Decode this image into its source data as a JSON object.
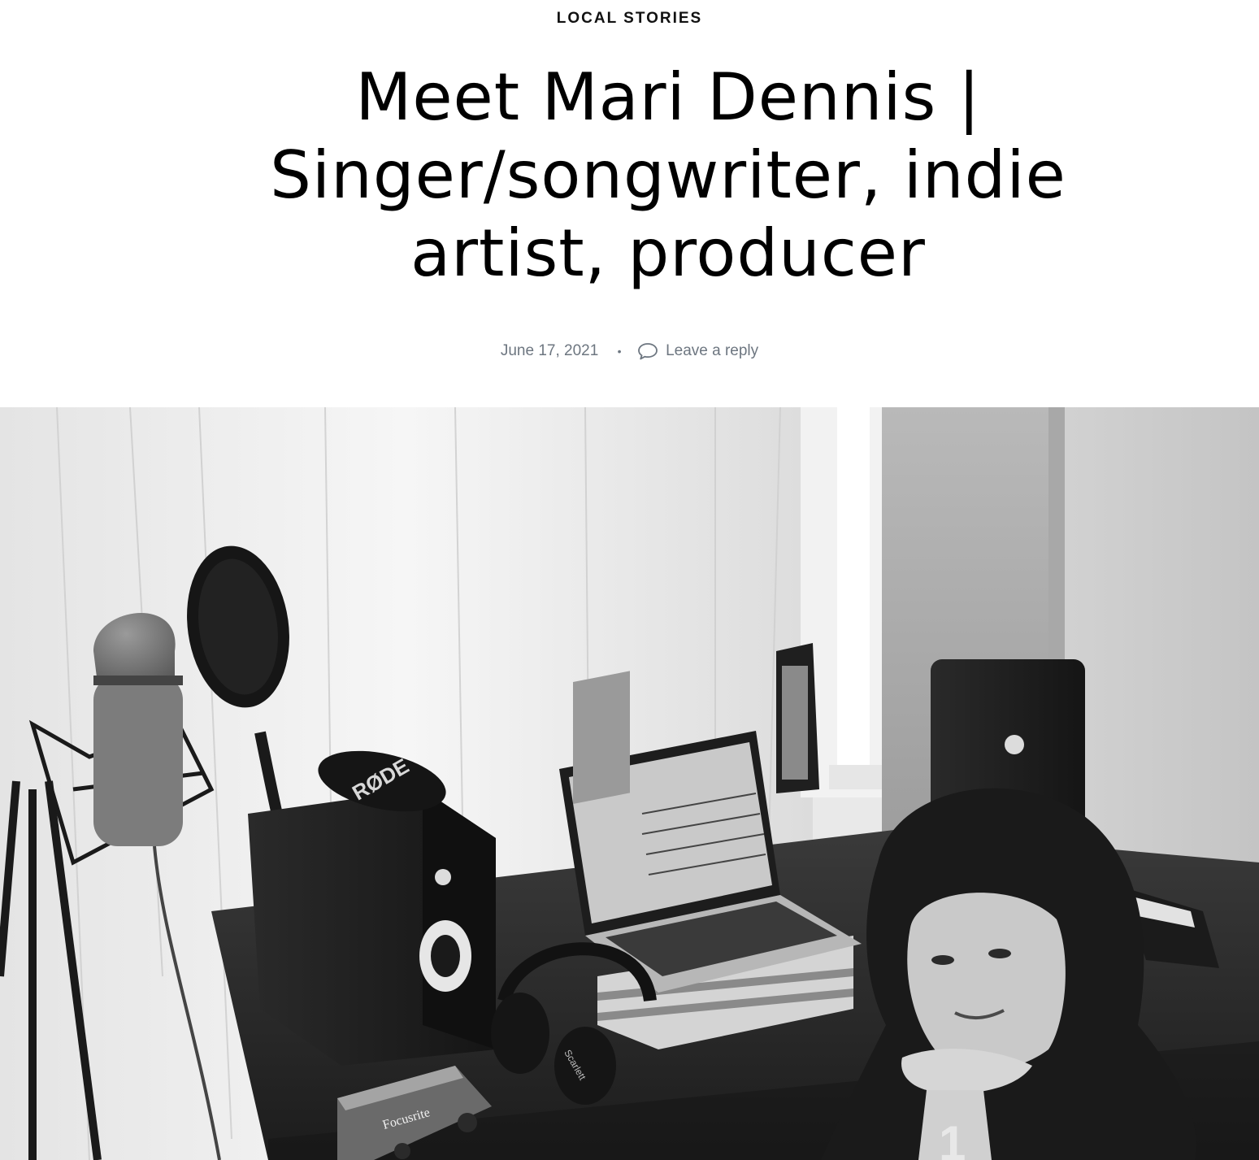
{
  "post": {
    "category": "LOCAL STORIES",
    "title": "Meet Mari Dennis | Singer/songwriter, indie artist, producer",
    "date": "June 17, 2021",
    "separator": "•",
    "reply_link": "Leave a reply"
  },
  "hero_image": {
    "alt": "Black and white photo of a home recording studio with a microphone, pop filter, studio monitors, laptop, headphones and audio interface on a desk, with a woman resting her chin on her hand",
    "mic_brand": "RØDE",
    "interface_brand": "Focusrite",
    "headphones_brand": "Scarlett"
  },
  "colors": {
    "text": "#000000",
    "meta": "#6d7680",
    "background": "#ffffff"
  }
}
